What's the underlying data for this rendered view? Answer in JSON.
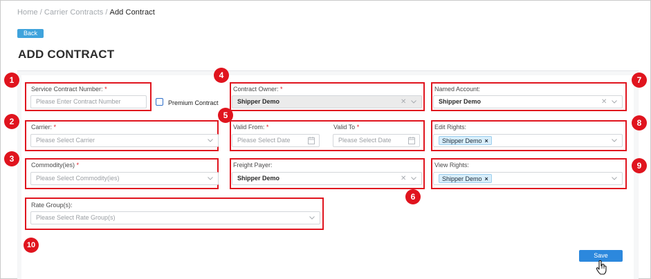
{
  "breadcrumb": {
    "home": "Home",
    "carrier_contracts": "Carrier Contracts",
    "current": "Add Contract",
    "separator": "/"
  },
  "back_label": "Back",
  "page_title": "ADD CONTRACT",
  "fields": {
    "service_contract_number": {
      "label": "Service Contract Number:",
      "required": "*",
      "placeholder": "Please Enter Contract Number"
    },
    "premium_contract": {
      "label": "Premium Contract",
      "checked": false
    },
    "contract_owner": {
      "label": "Contract Owner:",
      "required": "*",
      "value": "Shipper Demo"
    },
    "named_account": {
      "label": "Named Account:",
      "value": "Shipper Demo"
    },
    "carrier": {
      "label": "Carrier:",
      "required": "*",
      "placeholder": "Please Select Carrier"
    },
    "valid_from": {
      "label": "Valid From:",
      "required": "*",
      "placeholder": "Please Select Date"
    },
    "valid_to": {
      "label": "Valid To",
      "required": "*",
      "placeholder": "Please Select Date"
    },
    "edit_rights": {
      "label": "Edit Rights:",
      "tag": "Shipper Demo"
    },
    "commodities": {
      "label": "Commodity(ies)",
      "required": "*",
      "placeholder": "Please Select Commodity(ies)"
    },
    "freight_payer": {
      "label": "Freight Payer:",
      "value": "Shipper Demo"
    },
    "view_rights": {
      "label": "View Rights:",
      "tag": "Shipper Demo"
    },
    "rate_groups": {
      "label": "Rate Group(s):",
      "placeholder": "Please Select Rate Group(s)"
    }
  },
  "callouts": [
    "1",
    "2",
    "3",
    "4",
    "5",
    "6",
    "7",
    "8",
    "9",
    "10"
  ],
  "save_label": "Save",
  "glyphs": {
    "clear": "✕",
    "tag_remove": "×"
  },
  "colors": {
    "highlight": "#e0141e",
    "primary_button": "#2c88dd",
    "back_button": "#3fa3dc",
    "tag_bg": "#d8eefb"
  }
}
